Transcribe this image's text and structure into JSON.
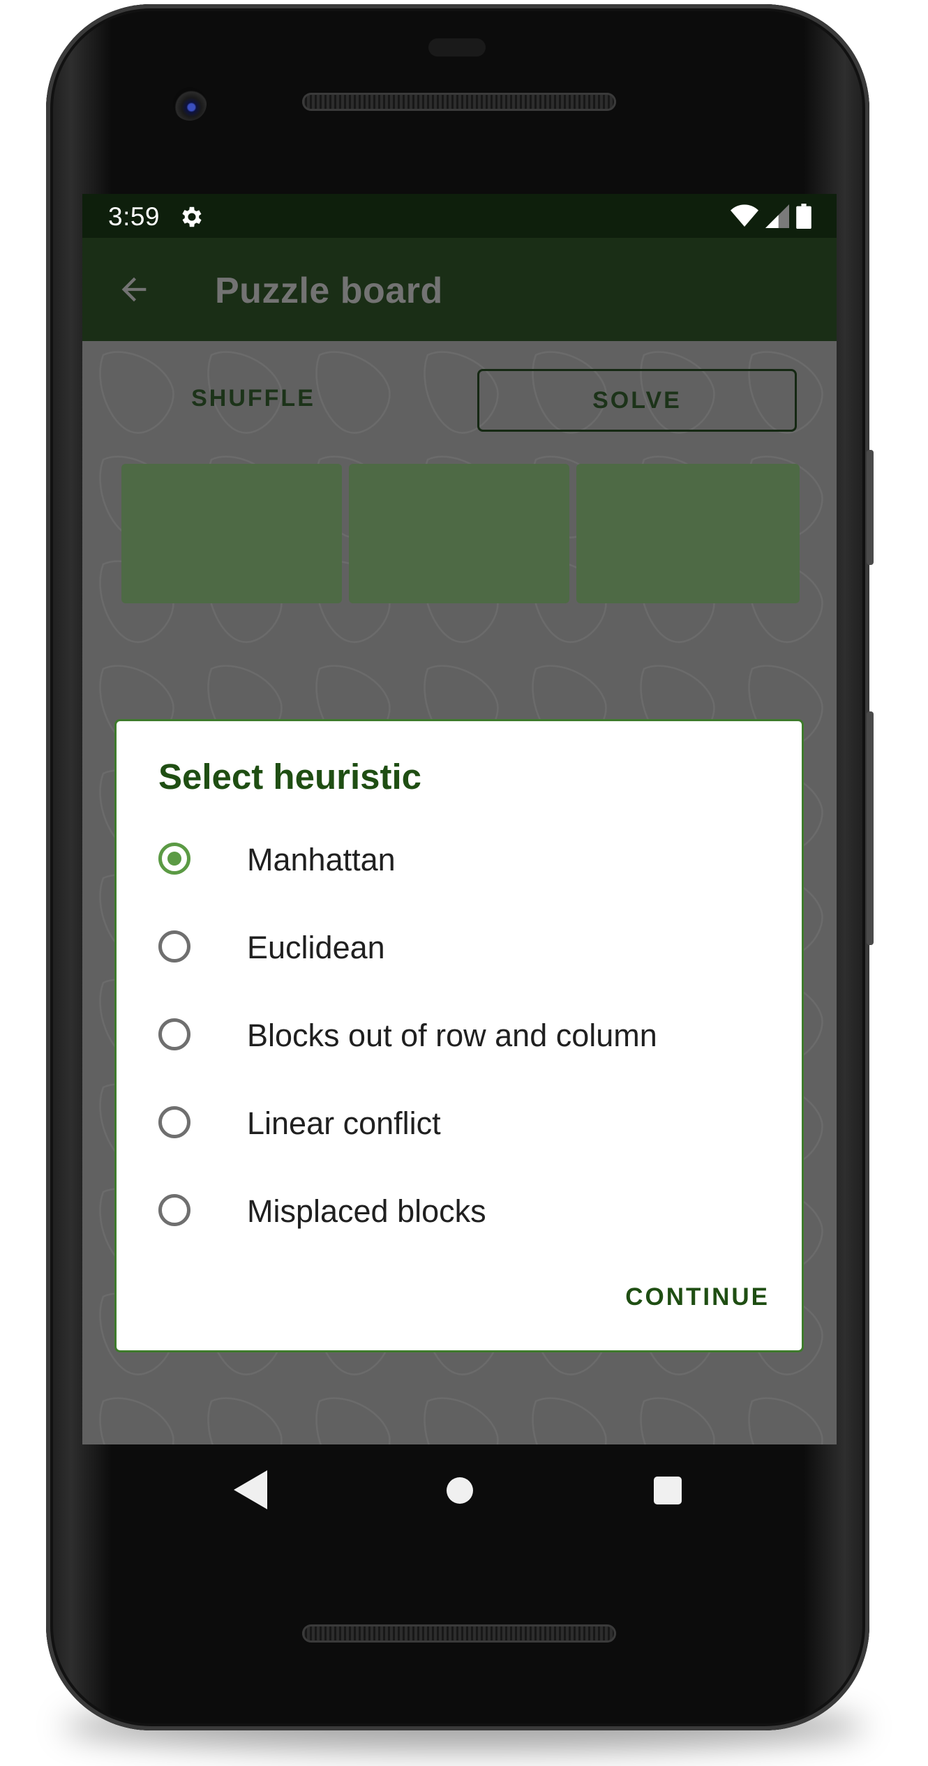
{
  "status_bar": {
    "time": "3:59",
    "settings_icon": "gear-icon",
    "wifi_icon": "wifi-icon",
    "signal_icon": "signal-icon",
    "battery_icon": "battery-icon"
  },
  "app_bar": {
    "back_icon": "arrow-left-icon",
    "title": "Puzzle board"
  },
  "toolbar": {
    "shuffle_label": "SHUFFLE",
    "solve_label": "SOLVE"
  },
  "dialog": {
    "title": "Select heuristic",
    "options": [
      {
        "label": "Manhattan",
        "selected": true
      },
      {
        "label": "Euclidean",
        "selected": false
      },
      {
        "label": "Blocks out of row and column",
        "selected": false
      },
      {
        "label": "Linear conflict",
        "selected": false
      },
      {
        "label": "Misplaced blocks",
        "selected": false
      }
    ],
    "continue_label": "CONTINUE"
  },
  "nav_bar": {
    "back_icon": "triangle-back-icon",
    "home_icon": "circle-home-icon",
    "recents_icon": "square-recents-icon"
  },
  "colors": {
    "status_bar_bg": "#0e1f0c",
    "app_bar_bg": "#1a2e16",
    "accent": "#5b9a44",
    "dialog_title": "#1f4e13",
    "scrim": "#616161"
  }
}
